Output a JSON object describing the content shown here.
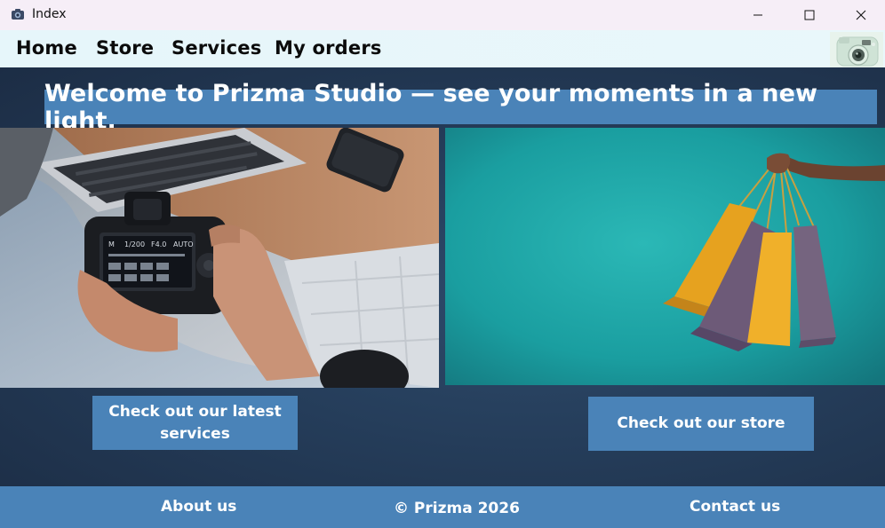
{
  "window": {
    "title": "Index",
    "icon": "camera-app-icon",
    "controls": {
      "minimize": "minimize-icon",
      "maximize": "maximize-icon",
      "close": "close-icon"
    }
  },
  "menu": {
    "items": [
      {
        "label": "Home"
      },
      {
        "label": "Store"
      },
      {
        "label": "Services"
      },
      {
        "label": "My orders"
      }
    ],
    "logo": "instant-camera-logo"
  },
  "main": {
    "welcome": "Welcome to Prizma Studio — see your moments in a new light.",
    "left_image": "photographer-holding-camera-photo",
    "right_image": "hand-holding-shopping-bags-photo",
    "services_button": "Check out our latest services",
    "store_button": "Check out our store"
  },
  "footer": {
    "about": "About us",
    "copyright": "© Prizma 2026",
    "contact": "Contact us"
  },
  "colors": {
    "accent": "#4a83b8",
    "background_dark": "#253d5a",
    "menubar": "#e6f6fa",
    "titlebar": "#f6eef7",
    "teal_photo": "#1fa6a8"
  }
}
